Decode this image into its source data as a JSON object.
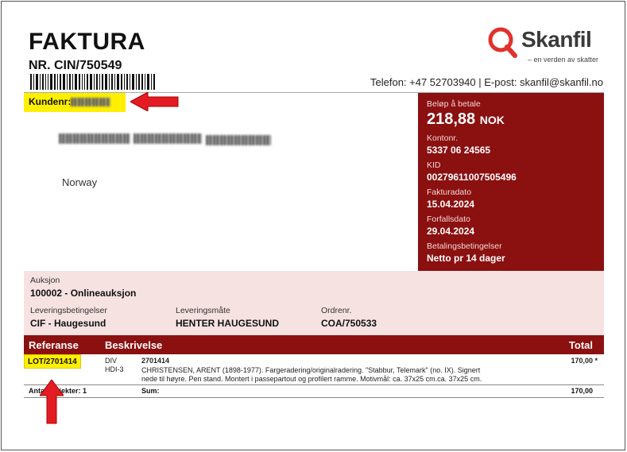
{
  "header": {
    "title": "FAKTURA",
    "invoice_nr": "NR. CIN/750549",
    "brand": "Skanfil",
    "tagline": "– en verden av skatter",
    "contact": "Telefon: +47 52703940 | E-post: skanfil@skanfil.no"
  },
  "customer": {
    "kundenr_label": "Kundenr:",
    "country": "Norway"
  },
  "payment": {
    "amount_label": "Beløp å betale",
    "amount": "218,88",
    "currency": "NOK",
    "account_label": "Kontonr.",
    "account": "5337 06 24565",
    "kid_label": "KID",
    "kid": "00279611007505496",
    "invoice_date_label": "Fakturadato",
    "invoice_date": "15.04.2024",
    "due_date_label": "Forfallsdato",
    "due_date": "29.04.2024",
    "terms_label": "Betalingsbetingelser",
    "terms": "Netto pr 14 dager"
  },
  "auction": {
    "label": "Auksjon",
    "value": "100002 - Onlineauksjon",
    "delivery_terms_label": "Leveringsbetingelser",
    "delivery_terms": "CIF - Haugesund",
    "delivery_method_label": "Leveringsmåte",
    "delivery_method": "HENTER HAUGESUND",
    "order_label": "Ordrenr.",
    "order": "COA/750533"
  },
  "table": {
    "col_ref": "Referanse",
    "col_desc": "Beskrivelse",
    "col_total": "Total",
    "rows": [
      {
        "ref": "LOT/2701414",
        "type1": "DIV",
        "type2": "HDI-3",
        "code": "2701414",
        "desc1": "CHRISTENSEN, ARENT (1898-1977). Fargeradering/originalradering. \"Stabbur, Telemark\" (no. IX). Signert",
        "desc2": "nede til høyre. Pen stand. Montert i passepartout og profilert ramme. Motivmål: ca. 37x25 cm.ca. 37x25 cm.",
        "total": "170,00 *"
      }
    ],
    "count_label": "Antall objekter: 1",
    "sum_label": "Sum:",
    "sum": "170,00"
  },
  "colors": {
    "brand_red": "#8b1010",
    "highlight": "#ffef00",
    "annotation_red": "#e31b23"
  }
}
